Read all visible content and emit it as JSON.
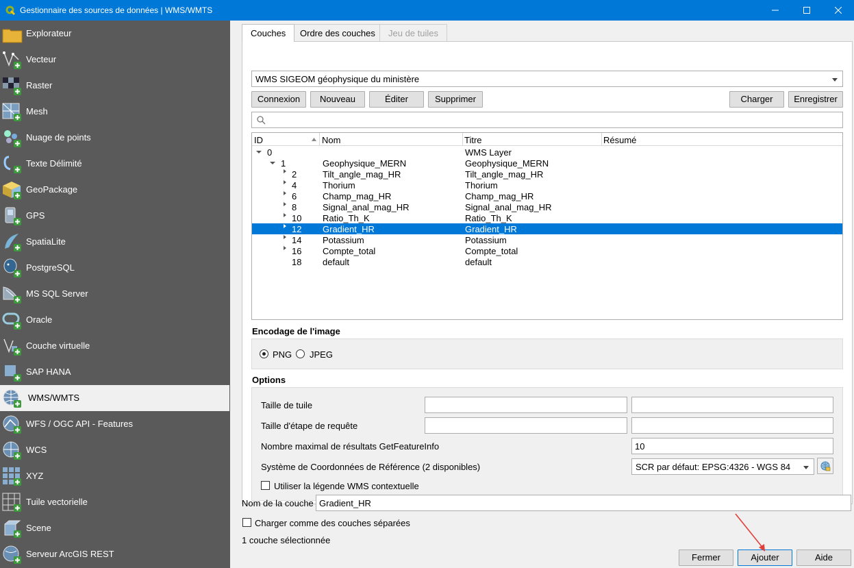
{
  "window": {
    "title": "Gestionnaire des sources de données | WMS/WMTS"
  },
  "sidebar": {
    "items": [
      {
        "label": "Explorateur",
        "icon": "folder-icon"
      },
      {
        "label": "Vecteur",
        "icon": "vector-icon"
      },
      {
        "label": "Raster",
        "icon": "raster-icon"
      },
      {
        "label": "Mesh",
        "icon": "mesh-icon"
      },
      {
        "label": "Nuage de points",
        "icon": "point-cloud-icon"
      },
      {
        "label": "Texte Délimité",
        "icon": "delimited-text-icon"
      },
      {
        "label": "GeoPackage",
        "icon": "geopackage-icon"
      },
      {
        "label": "GPS",
        "icon": "gps-icon"
      },
      {
        "label": "SpatiaLite",
        "icon": "spatialite-icon"
      },
      {
        "label": "PostgreSQL",
        "icon": "postgresql-icon"
      },
      {
        "label": "MS SQL Server",
        "icon": "mssql-icon"
      },
      {
        "label": "Oracle",
        "icon": "oracle-icon"
      },
      {
        "label": "Couche virtuelle",
        "icon": "virtual-layer-icon"
      },
      {
        "label": "SAP HANA",
        "icon": "sap-hana-icon"
      },
      {
        "label": "WMS/WMTS",
        "icon": "wms-icon"
      },
      {
        "label": "WFS / OGC API - Features",
        "icon": "wfs-icon"
      },
      {
        "label": "WCS",
        "icon": "wcs-icon"
      },
      {
        "label": "XYZ",
        "icon": "xyz-icon"
      },
      {
        "label": "Tuile vectorielle",
        "icon": "vector-tile-icon"
      },
      {
        "label": "Scene",
        "icon": "scene-icon"
      },
      {
        "label": "Serveur ArcGIS REST",
        "icon": "arcgis-rest-icon"
      }
    ],
    "active_index": 14
  },
  "tabs": [
    {
      "label": "Couches",
      "state": "active"
    },
    {
      "label": "Ordre des couches",
      "state": "normal"
    },
    {
      "label": "Jeu de tuiles",
      "state": "disabled"
    }
  ],
  "connection": {
    "selected": "WMS SIGEOM géophysique du ministère",
    "buttons": {
      "connect": "Connexion",
      "new": "Nouveau",
      "edit": "Éditer",
      "delete": "Supprimer",
      "load": "Charger",
      "save": "Enregistrer"
    }
  },
  "search": {
    "placeholder": ""
  },
  "layer_tree": {
    "columns": [
      "ID",
      "Nom",
      "Titre",
      "Résumé"
    ],
    "rows": [
      {
        "id": "0",
        "name": "",
        "title": "WMS Layer",
        "depth": 0,
        "expander": "open",
        "selected": false
      },
      {
        "id": "1",
        "name": "Geophysique_MERN",
        "title": "Geophysique_MERN",
        "depth": 1,
        "expander": "open",
        "selected": false
      },
      {
        "id": "2",
        "name": "Tilt_angle_mag_HR",
        "title": "Tilt_angle_mag_HR",
        "depth": 2,
        "expander": "closed",
        "selected": false
      },
      {
        "id": "4",
        "name": "Thorium",
        "title": "Thorium",
        "depth": 2,
        "expander": "closed",
        "selected": false
      },
      {
        "id": "6",
        "name": "Champ_mag_HR",
        "title": "Champ_mag_HR",
        "depth": 2,
        "expander": "closed",
        "selected": false
      },
      {
        "id": "8",
        "name": "Signal_anal_mag_HR",
        "title": "Signal_anal_mag_HR",
        "depth": 2,
        "expander": "closed",
        "selected": false
      },
      {
        "id": "10",
        "name": "Ratio_Th_K",
        "title": "Ratio_Th_K",
        "depth": 2,
        "expander": "closed",
        "selected": false
      },
      {
        "id": "12",
        "name": "Gradient_HR",
        "title": "Gradient_HR",
        "depth": 2,
        "expander": "closed",
        "selected": true
      },
      {
        "id": "14",
        "name": "Potassium",
        "title": "Potassium",
        "depth": 2,
        "expander": "closed",
        "selected": false
      },
      {
        "id": "16",
        "name": "Compte_total",
        "title": "Compte_total",
        "depth": 2,
        "expander": "closed",
        "selected": false
      },
      {
        "id": "18",
        "name": "default",
        "title": "default",
        "depth": 2,
        "expander": "none",
        "selected": false
      }
    ]
  },
  "encoding": {
    "title": "Encodage de l'image",
    "options": [
      {
        "label": "PNG",
        "checked": true
      },
      {
        "label": "JPEG",
        "checked": false
      }
    ]
  },
  "options": {
    "title": "Options",
    "tile_size_label": "Taille de tuile",
    "tile_size_w": "",
    "tile_size_h": "",
    "step_size_label": "Taille d'étape de requête",
    "step_size_w": "",
    "step_size_h": "",
    "max_results_label": "Nombre maximal de résultats GetFeatureInfo",
    "max_results_value": "10",
    "crs_label": "Système de Coordonnées de Référence (2 disponibles)",
    "crs_value": "SCR par défaut: EPSG:4326 - WGS 84",
    "contextual_legend_label": "Utiliser la légende WMS contextuelle",
    "contextual_legend_checked": false
  },
  "footer": {
    "layer_name_label": "Nom de la couche",
    "layer_name_value": "Gradient_HR",
    "separate_layers_label": "Charger comme des couches séparées",
    "status": "1 couche sélectionnée",
    "close": "Fermer",
    "add": "Ajouter",
    "help": "Aide"
  },
  "colors": {
    "accent": "#0078d7",
    "sidebar_bg": "#5a5a5a",
    "annotation_arrow": "#e0403a"
  }
}
